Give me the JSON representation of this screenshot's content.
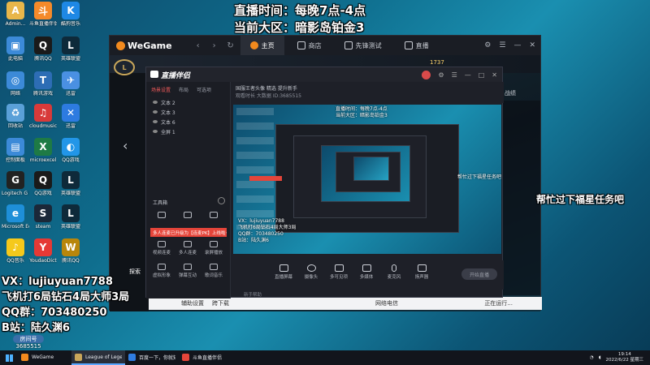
{
  "overlay": {
    "schedule": "直播时间：每晚7点-4点",
    "region": "当前大区：暗影岛铂金3",
    "side_note": "帮忙过下福星任务吧",
    "vx": "VX：lujiuyuan7788",
    "record": "飞机打6局钻石4局大师3局",
    "qq_group": "QQ群：703480250",
    "bilibili": "B站：陆久渊6",
    "room_label": "房间号",
    "room_number": "3685515"
  },
  "desktop_icons": [
    {
      "label": "Admin...",
      "color": "#e8b64a",
      "glyph": "A"
    },
    {
      "label": "斗鱼直播伴侣",
      "color": "#f58a2a",
      "glyph": "斗"
    },
    {
      "label": "酷狗音乐",
      "color": "#1e88e5",
      "glyph": "K"
    },
    {
      "label": "此电脑",
      "color": "#3c8ad8",
      "glyph": "▣"
    },
    {
      "label": "腾讯QQ",
      "color": "#1a1a1a",
      "glyph": "Q"
    },
    {
      "label": "英雄联盟",
      "color": "#0e2a3a",
      "glyph": "L"
    },
    {
      "label": "网络",
      "color": "#3c8ad8",
      "glyph": "◎"
    },
    {
      "label": "腾讯游戏",
      "color": "#2d6db5",
      "glyph": "T"
    },
    {
      "label": "迅雷",
      "color": "#4a90e2",
      "glyph": "✈"
    },
    {
      "label": "回收站",
      "color": "#5aa0d8",
      "glyph": "♻"
    },
    {
      "label": "cloudmusic",
      "color": "#d83a3a",
      "glyph": "♫"
    },
    {
      "label": "迅雷",
      "color": "#2d7be0",
      "glyph": "✕"
    },
    {
      "label": "控制面板",
      "color": "#3c8ad8",
      "glyph": "▤"
    },
    {
      "label": "microexcel",
      "color": "#1e7a45",
      "glyph": "X"
    },
    {
      "label": "QQ游戏",
      "color": "#2296e8",
      "glyph": "◐"
    },
    {
      "label": "Logitech G HUB",
      "color": "#222",
      "glyph": "G"
    },
    {
      "label": "QQ游戏",
      "color": "#1a1a1a",
      "glyph": "Q"
    },
    {
      "label": "英雄联盟",
      "color": "#0e2a3a",
      "glyph": "L"
    },
    {
      "label": "Microsoft Edge",
      "color": "#1e8fd8",
      "glyph": "e"
    },
    {
      "label": "steam",
      "color": "#1b2838",
      "glyph": "S"
    },
    {
      "label": "英雄联盟",
      "color": "#0e2a3a",
      "glyph": "L"
    },
    {
      "label": "QQ音乐",
      "color": "#f5c91b",
      "glyph": "♪"
    },
    {
      "label": "YoudaoDict",
      "color": "#e53935",
      "glyph": "Y"
    },
    {
      "label": "腾讯QQ",
      "color": "#b8860b",
      "glyph": "W"
    }
  ],
  "wegame": {
    "logo": "WeGame",
    "tabs": [
      {
        "label": "主页",
        "active": true,
        "color": "#f28a1e"
      },
      {
        "label": "商店",
        "active": false,
        "color": "#c8ccd3"
      },
      {
        "label": "先锋测试",
        "active": false,
        "color": "#c8ccd3"
      },
      {
        "label": "直播",
        "active": false,
        "color": "#c8ccd3"
      }
    ],
    "level": "1737",
    "right_label": "战绩",
    "left_item": "探索",
    "bottom_left": "辅助设置",
    "bottom_mid": "跨下载",
    "bottom_status": "网络电信",
    "launch_label": "正在运行..."
  },
  "live": {
    "logo": "直播伴侣",
    "tabs": [
      "场景设置",
      "布局",
      "可选项"
    ],
    "scenes": [
      "文本 2",
      "文本 3",
      "文本 6",
      "全屏 1"
    ],
    "tools_title": "工具箱",
    "notice": "多人连麦已升级为【连麦PK】上线啦~",
    "tools": [
      "视频连麦",
      "多人连麦",
      "录屏播放",
      "虚拟形象",
      "弹幕互动",
      "歌词音乐"
    ],
    "header_line1": "国服王者头像   精选   提升新手",
    "header_line2": "观看时长  大数据   ID:3685515",
    "bottom_tools": [
      "直播屏幕",
      "摄像头",
      "多可见项",
      "多媒体",
      "麦克风",
      "扬声器"
    ],
    "start_label": "开始直播",
    "footer_note": "新手帮助"
  },
  "taskbar": {
    "items": [
      {
        "label": "WeGame",
        "color": "#f28a1e",
        "active": false
      },
      {
        "label": "League of Legends",
        "color": "#c8a65a",
        "active": true
      },
      {
        "label": "百度一下，你就知...",
        "color": "#2f7de1",
        "active": false
      },
      {
        "label": "斗鱼直播伴侣",
        "color": "#e5453a",
        "active": false
      }
    ],
    "time": "19:14",
    "date": "2022/6/22 星期三"
  }
}
